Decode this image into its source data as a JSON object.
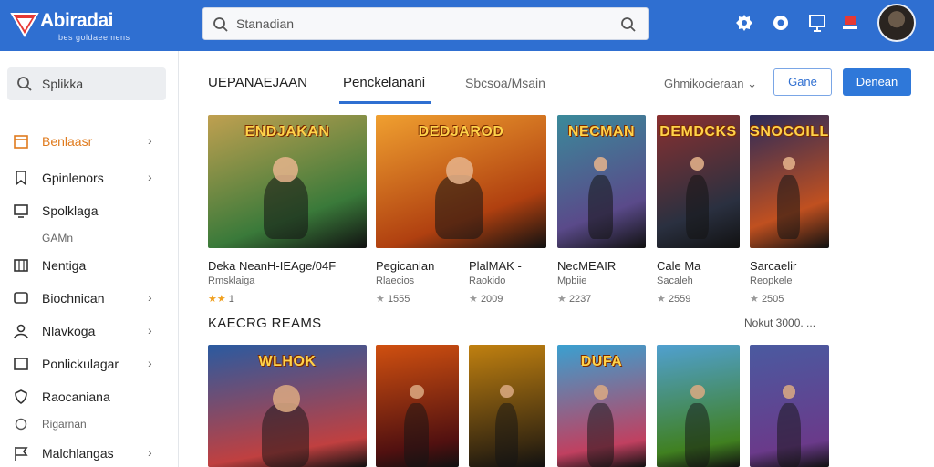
{
  "header": {
    "app_title": "Abiradai",
    "app_subtitle": "bes goldaeemens",
    "search_placeholder": "Stanadian",
    "icons": [
      "gear-icon",
      "settings-icon",
      "cast-icon",
      "notification-icon"
    ]
  },
  "sidebar": {
    "search_label": "Splikka",
    "items": [
      {
        "label": "Benlaasr",
        "icon": "calendar-icon",
        "chevron": true,
        "active": true
      },
      {
        "label": "Gpinlenors",
        "icon": "bookmark-icon",
        "chevron": true
      },
      {
        "label": "Spolklaga",
        "icon": "monitor-icon",
        "chevron": false
      },
      {
        "label": "Nentiga",
        "icon": "grid-icon",
        "chevron": false
      },
      {
        "label": "Biochnican",
        "icon": "chat-icon",
        "chevron": true
      },
      {
        "label": "Nlavkoga",
        "icon": "user-icon",
        "chevron": true
      },
      {
        "label": "Ponlickulagar",
        "icon": "square-icon",
        "chevron": true
      },
      {
        "label": "Raocaniana",
        "icon": "shield-icon",
        "chevron": false
      },
      {
        "label": "Malchlangas",
        "icon": "flag-icon",
        "chevron": true
      }
    ],
    "sub_items": [
      "GAMn",
      "Rigarnan"
    ]
  },
  "main": {
    "tabs": [
      "UEPANAEJAAN",
      "Penckelanani",
      "Sbcsoa/Msain"
    ],
    "sort_label": "Ghmikocieraan",
    "btn_outline": "Gane",
    "btn_primary": "Denean",
    "row1": [
      {
        "logo": "ENDJAKAN",
        "title": "Deka NeanH-IEAge/04F",
        "sub": "Rmsklaiga",
        "rating": "1",
        "colors": [
          "#3a7a3a",
          "#c0a050"
        ]
      },
      {
        "logo": "DEDJAROD",
        "title": "Pegicanlan",
        "sub": "Rlaecios",
        "rating": "1555",
        "colors": [
          "#b04010",
          "#f0a030"
        ]
      },
      {
        "logo": "",
        "title": "PlalMAK -",
        "sub": "Raokido",
        "rating": "2009",
        "colors": [
          "#7a2a80",
          "#2a5a9a"
        ]
      },
      {
        "logo": "NECMAN",
        "title": "NecMEAIR",
        "sub": "Mpbiie",
        "rating": "2237",
        "colors": [
          "#5a4a8a",
          "#3a8a9a"
        ]
      },
      {
        "logo": "DEMDCKS",
        "title": "Cale Ma",
        "sub": "Sacaleh",
        "rating": "2559",
        "colors": [
          "#2a3040",
          "#8a3030"
        ]
      },
      {
        "logo": "SNOCOILL",
        "title": "Sarcaelir",
        "sub": "Reopkele",
        "rating": "2505",
        "colors": [
          "#c05020",
          "#2a2a5a"
        ]
      }
    ],
    "section_title": "KAECRG REAMS",
    "section_link": "Nokut 3000. ...",
    "row2": [
      {
        "logo": "WLHOK",
        "colors": [
          "#2a5aa0",
          "#c04040"
        ]
      },
      {
        "logo": "",
        "colors": [
          "#d05010",
          "#501010"
        ]
      },
      {
        "logo": "",
        "colors": [
          "#c08010",
          "#3a2a10"
        ]
      },
      {
        "logo": "DUFA",
        "colors": [
          "#3aa0d0",
          "#c04060"
        ]
      },
      {
        "logo": "",
        "colors": [
          "#50a0d0",
          "#408020"
        ]
      },
      {
        "logo": "",
        "colors": [
          "#4a5aa0",
          "#6a3a8a"
        ]
      }
    ]
  }
}
